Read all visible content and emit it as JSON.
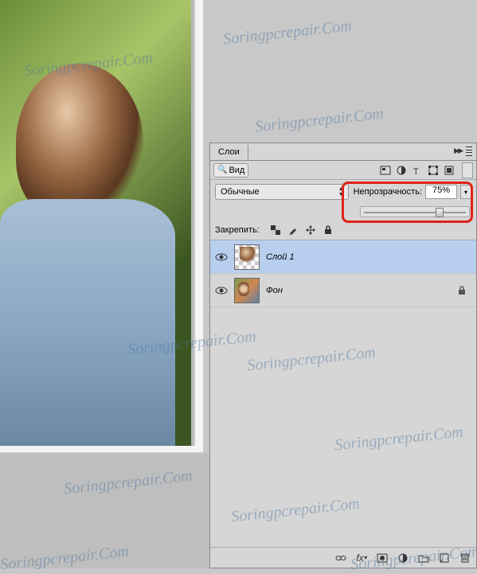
{
  "watermark_text": "Soringpcrepair.Com",
  "panel": {
    "tab_label": "Слои",
    "search_label": "Вид",
    "blend_mode": "Обычные",
    "opacity": {
      "label": "Непрозрачность:",
      "value": "75%",
      "slider_percent": 75
    },
    "lock_label": "Закрепить:",
    "layers": [
      {
        "name": "Слой 1",
        "visible": true,
        "selected": true,
        "locked": false
      },
      {
        "name": "Фон",
        "visible": true,
        "selected": false,
        "locked": true
      }
    ],
    "bottom_icons": [
      "link",
      "fx",
      "mask",
      "adjust",
      "group",
      "new",
      "trash"
    ]
  }
}
